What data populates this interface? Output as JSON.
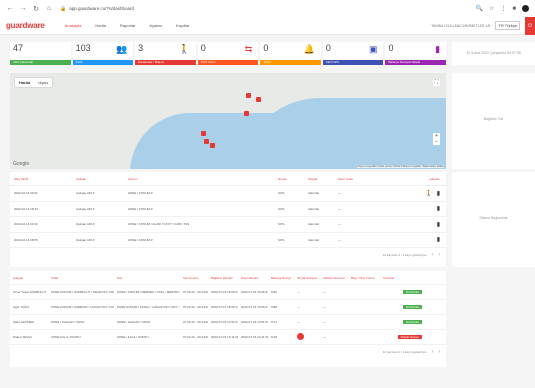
{
  "browser": {
    "url": "app.guardware.co/?n/dashboard",
    "nav_icons": [
      "←",
      "→",
      "↻",
      "⌂"
    ],
    "right_icons": [
      "🔍",
      "☆",
      "⋮",
      "■"
    ]
  },
  "header": {
    "logo": "guardware",
    "nav": [
      "Anasayfa",
      "Harita",
      "Raporlar",
      "Ayarlar",
      "Kayıtlar"
    ],
    "right_text": "TANIMLI KULLANICI/HIZMETLER 1/5",
    "lang": "TR Türkçe",
    "logout": "⏻"
  },
  "stats": [
    {
      "value": "47",
      "label": "Aktif Çalışanlar",
      "color": "#4caf50",
      "icon": "",
      "icon_color": "#4caf50"
    },
    {
      "value": "103",
      "label": "Pasif",
      "color": "#2196f3",
      "icon": "👥",
      "icon_color": "#4caf50"
    },
    {
      "value": "3",
      "label": "Hareketsiz / Düşme",
      "color": "#e53935",
      "icon": "🚶",
      "icon_color": "#2196f3"
    },
    {
      "value": "0",
      "label": "SOS Alarm",
      "color": "#ff5722",
      "icon": "⇆",
      "icon_color": "#e53935"
    },
    {
      "value": "0",
      "label": "Alarm",
      "color": "#ff9800",
      "icon": "🔔",
      "icon_color": "#ff9800"
    },
    {
      "value": "0",
      "label": "Aktif GPS",
      "color": "#3f51b5",
      "icon": "▣",
      "icon_color": "#3f51b5"
    },
    {
      "value": "0",
      "label": "Batarya Seviyesi Düşük",
      "color": "#9c27b0",
      "icon": "▮",
      "icon_color": "#9c27b0"
    }
  ],
  "right_panels": {
    "top": "15 Şubat 2022 Çarşamba 09:57:58",
    "map": "Bağlantı Yok",
    "table": "Sistem Bağlantılar"
  },
  "map": {
    "toggle": [
      "Harita",
      "Uydu"
    ],
    "google": "Google",
    "attrib": "Klavye kısayolları   Harita verileri ©2022   Kullanım Koşulları   Harita hatası bildirin"
  },
  "alarms": {
    "headers": [
      "Olay Tarihi",
      "Çalışan",
      "Konum",
      "Durum",
      "Olaylar",
      "İşlem Kodu",
      "İşlemler"
    ],
    "rows": [
      [
        "2022-02-15 09:21",
        "Çalışan ADI #",
        "ZONE / KONUM #",
        "SOS",
        "Alarmlar",
        "—"
      ],
      [
        "2022-02-14 18:44",
        "Çalışan ADI #",
        "ZONE / KONUM #",
        "SOS",
        "Alarmlar",
        "—"
      ],
      [
        "2022-02-14 09:10",
        "Çalışan ADI #",
        "ZONE / KONUM / ALANI / KAYIT / GÖR / TAŞ",
        "SOS",
        "Alarmlar",
        "—"
      ],
      [
        "2022-02-14 08:55",
        "Çalışan ADI #",
        "ZONE / KONUM #",
        "SOS",
        "Alarmlar",
        "—"
      ]
    ],
    "pager": "10 kayıttan 4 / 4 kayıt gösteriliyor"
  },
  "devices": {
    "headers": [
      "Çalışan",
      "Cihaz",
      "Son",
      "Son Konum",
      "Bağlantı Zamanı",
      "Kayıt Zamanı",
      "Batarya Seviye",
      "Sinyal Seviyesi",
      "Aktivite Seviyesi",
      "Bilgi / Olay Formu",
      "Görevler"
    ],
    "rows": [
      [
        "Ömer Yaşar GÜRBULUT",
        "ZONE KONUM / GÜRBULUT / TELEFON / ANDROID",
        "ZONE / KONUM / MERKEZ / OTEL / MERTİM / BARAJ",
        "07.02.22 - 09:14:00",
        "2022-07-15 15:05:27",
        "2022-07-15 15:05:33",
        "%92",
        "—",
        "—",
        "Görüntüle"
      ],
      [
        "Uğur YAĞCI",
        "ZONE KONUM / ANDROID / LOKASYON / KANAL / ANT",
        "ZONE KONUM / KANAL / LOKASYON / ANT / TEL",
        "07.02.22 - 09:14:00",
        "2022-07-15 15:05:17",
        "2022-07-15 15:05:21",
        "%88",
        "—",
        "—",
        "Görüntüle"
      ],
      [
        "Şakir ÇETİNER",
        "ZONE / KALKAN / ORTA",
        "ZONE / KALKAN / ORTA",
        "07.02.22 - 09:14:00",
        "2022-07-15 14:51:51",
        "2022-07-15 14:51:56",
        "%71",
        "—",
        "—",
        "Görüntüle"
      ],
      [
        "Didem SEVGİ",
        "ZONE KALA / KUMTU",
        "ZONE / KALA / SUMTU",
        "07.02.22 - 09:14:00",
        "2022-07-15 14:11:28",
        "2022-07-15 14:11:31",
        "%18",
        "●",
        "—",
        "Düşük Seviye"
      ]
    ],
    "pager": "10 kayıttan 4 / 4 kayıt gösteriliyor"
  }
}
